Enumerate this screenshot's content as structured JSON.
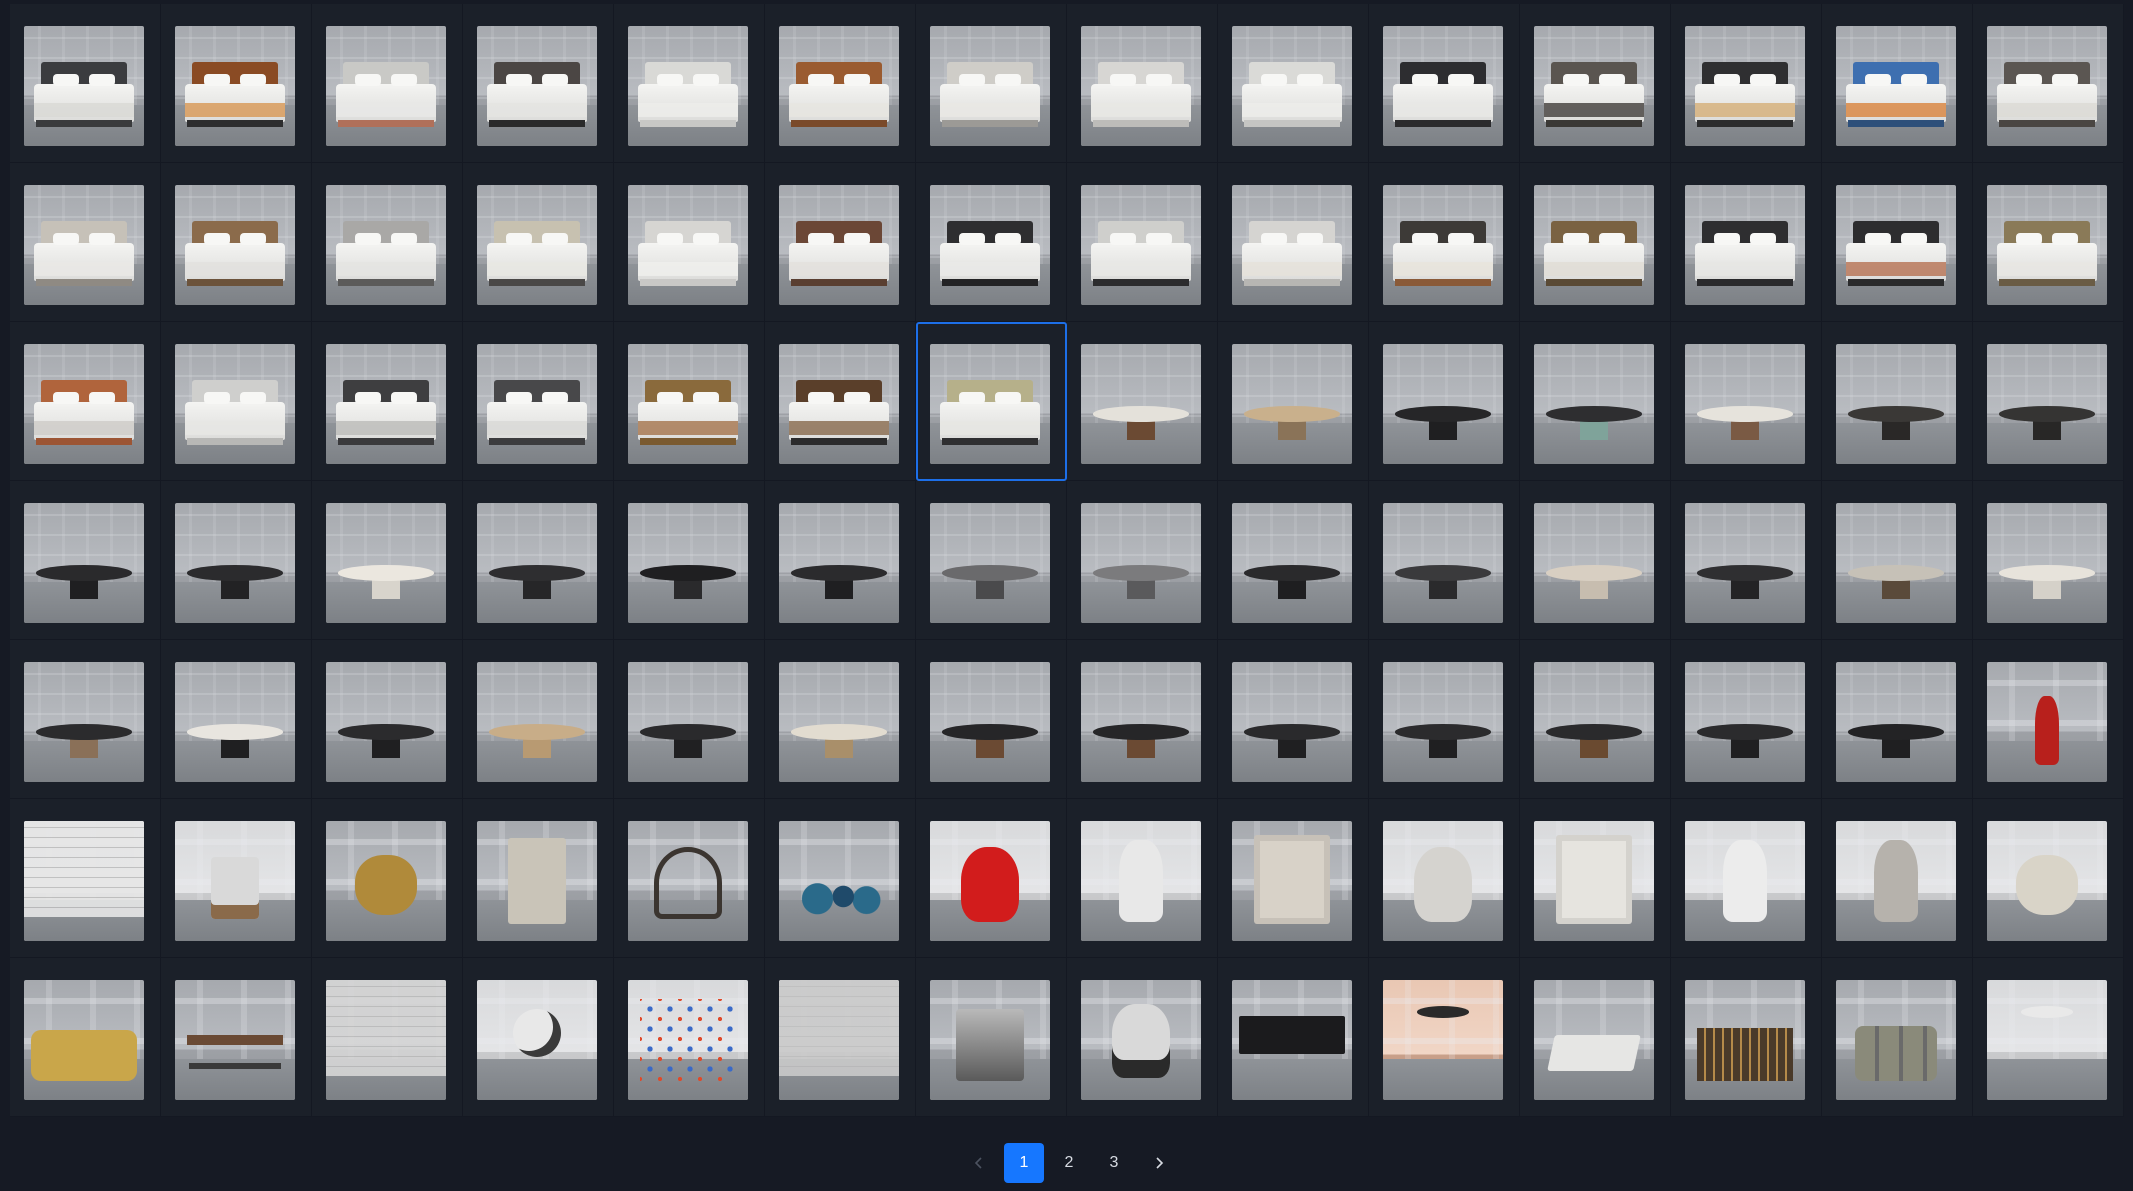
{
  "gallery": {
    "columns": 14,
    "selected_index": 34,
    "items": [
      {
        "kind": "bed",
        "head": "#3b3c3f",
        "throw": "#d9d9d6",
        "base": "#3a3b3d"
      },
      {
        "kind": "bed",
        "head": "#8a4b24",
        "throw": "#d89b5c",
        "base": "#2d2d2e"
      },
      {
        "kind": "bed",
        "head": "#c9c9c6",
        "throw": "#e8e8e6",
        "base": "#b0705a"
      },
      {
        "kind": "bed",
        "head": "#4b4644",
        "throw": "#e4e4e2",
        "base": "#2a2a2b"
      },
      {
        "kind": "bed",
        "head": "#d9d9d6",
        "throw": "#ececea",
        "base": "#c8c8c6"
      },
      {
        "kind": "bed",
        "head": "#9a5b30",
        "throw": "#e6e5e1",
        "base": "#7a4a2a"
      },
      {
        "kind": "bed",
        "head": "#cfcdc8",
        "throw": "#e9e8e4",
        "base": "#9c9a96"
      },
      {
        "kind": "bed",
        "head": "#d7d6d3",
        "throw": "#e8e7e4",
        "base": "#bdbcb9"
      },
      {
        "kind": "bed",
        "head": "#dadad7",
        "throw": "#ececea",
        "base": "#c5c5c3"
      },
      {
        "kind": "bed",
        "head": "#2d2d30",
        "throw": "#e7e7e5",
        "base": "#2b2b2d"
      },
      {
        "kind": "bed",
        "head": "#5a5550",
        "throw": "#4a4744",
        "base": "#3a3835"
      },
      {
        "kind": "bed",
        "head": "#2f2f31",
        "throw": "#d6b27e",
        "base": "#2c2c2d"
      },
      {
        "kind": "bed",
        "head": "#3e6fb0",
        "throw": "#d98845",
        "base": "#2d4f7a"
      },
      {
        "kind": "bed",
        "head": "#5b5652",
        "throw": "#dcdad6",
        "base": "#4a4643"
      },
      {
        "kind": "bed",
        "head": "#c6c1b8",
        "throw": "#e9e8e5",
        "base": "#8f8a83"
      },
      {
        "kind": "bed",
        "head": "#8b6b4b",
        "throw": "#e2e1de",
        "base": "#6c533b"
      },
      {
        "kind": "bed",
        "head": "#a9a8a6",
        "throw": "#e4e4e2",
        "base": "#5c5b5a"
      },
      {
        "kind": "bed",
        "head": "#c7c1b0",
        "throw": "#e8e7e3",
        "base": "#4a4847"
      },
      {
        "kind": "bed",
        "head": "#d6d5d2",
        "throw": "#eeeeec",
        "base": "#c9c8c6"
      },
      {
        "kind": "bed",
        "head": "#6b4736",
        "throw": "#e3e1dd",
        "base": "#5a3f31"
      },
      {
        "kind": "bed",
        "head": "#2e2e30",
        "throw": "#e9e9e7",
        "base": "#232325"
      },
      {
        "kind": "bed",
        "head": "#cfcfcc",
        "throw": "#e7e7e5",
        "base": "#2c2c2e"
      },
      {
        "kind": "bed",
        "head": "#d5d4d1",
        "throw": "#e5e2da",
        "base": "#b7b6b3"
      },
      {
        "kind": "bed",
        "head": "#3d3a37",
        "throw": "#e8e4dc",
        "base": "#8a5a38"
      },
      {
        "kind": "bed",
        "head": "#7a6242",
        "throw": "#e0ddd6",
        "base": "#5a4a35"
      },
      {
        "kind": "bed",
        "head": "#2e2e30",
        "throw": "#e6e6e4",
        "base": "#2a2a2c"
      },
      {
        "kind": "bed",
        "head": "#2d2d2f",
        "throw": "#b9785a",
        "base": "#2a2a2b"
      },
      {
        "kind": "bed",
        "head": "#8a7a58",
        "throw": "#e7e6e3",
        "base": "#6a5c45"
      },
      {
        "kind": "bed",
        "head": "#b0643c",
        "throw": "#cfcdc9",
        "base": "#9c5534"
      },
      {
        "kind": "bed",
        "head": "#cfcfcd",
        "throw": "#e6e6e4",
        "base": "#b8b8b6"
      },
      {
        "kind": "bed",
        "head": "#3e3e40",
        "throw": "#bdbdbb",
        "base": "#3a3a3c"
      },
      {
        "kind": "bed",
        "head": "#48484a",
        "throw": "#d9d9d7",
        "base": "#3c3c3e"
      },
      {
        "kind": "bed",
        "head": "#8a6a3c",
        "throw": "#a87a55",
        "base": "#7a5a30"
      },
      {
        "kind": "bed",
        "head": "#5a3f2a",
        "throw": "#8c7055",
        "base": "#2b2b2c"
      },
      {
        "kind": "bed",
        "head": "#b6b08a",
        "throw": "#e6e6e3",
        "base": "#2f2f31"
      },
      {
        "kind": "table",
        "top": "#e4e1da",
        "leg": "#6b4a33"
      },
      {
        "kind": "table",
        "top": "#c9b08c",
        "leg": "#8a7358"
      },
      {
        "kind": "table",
        "top": "#262628",
        "leg": "#1f1f21"
      },
      {
        "kind": "table",
        "top": "#2e2e30",
        "leg": "#7fa39a"
      },
      {
        "kind": "table",
        "top": "#e6e3dc",
        "leg": "#7a5a44"
      },
      {
        "kind": "table",
        "top": "#3a3836",
        "leg": "#2a2827"
      },
      {
        "kind": "table",
        "top": "#353433",
        "leg": "#282726"
      },
      {
        "kind": "table",
        "top": "#2a2a2c",
        "leg": "#1f1f21"
      },
      {
        "kind": "table",
        "top": "#2b2b2d",
        "leg": "#222224"
      },
      {
        "kind": "table",
        "top": "#ebe7df",
        "leg": "#d8d4cc"
      },
      {
        "kind": "table",
        "top": "#2e2e30",
        "leg": "#262628"
      },
      {
        "kind": "table",
        "top": "#1f1f21",
        "leg": "#2a2a2c"
      },
      {
        "kind": "table",
        "top": "#2b2b2d",
        "leg": "#1f1f21"
      },
      {
        "kind": "table",
        "top": "#6a6a6c",
        "leg": "#4a4a4c"
      },
      {
        "kind": "table",
        "top": "#7b7b7d",
        "leg": "#5a5a5c"
      },
      {
        "kind": "table",
        "top": "#2a2a2c",
        "leg": "#1e1e20"
      },
      {
        "kind": "table",
        "top": "#3a3a3c",
        "leg": "#2a2a2c"
      },
      {
        "kind": "table",
        "top": "#d8cfc2",
        "leg": "#c7bdaf"
      },
      {
        "kind": "table",
        "top": "#2f2f31",
        "leg": "#232325"
      },
      {
        "kind": "table",
        "top": "#c6c1b7",
        "leg": "#5a4a3a"
      },
      {
        "kind": "table",
        "top": "#e7e3db",
        "leg": "#d5d1c9"
      },
      {
        "kind": "table",
        "top": "#2b2b2d",
        "leg": "#8a7058"
      },
      {
        "kind": "table",
        "top": "#e8e5df",
        "leg": "#1f1f21"
      },
      {
        "kind": "table",
        "top": "#2b2b2d",
        "leg": "#1f1f21"
      },
      {
        "kind": "table",
        "top": "#c8ad88",
        "leg": "#b89a72"
      },
      {
        "kind": "table",
        "top": "#2a2a2c",
        "leg": "#202022"
      },
      {
        "kind": "table",
        "top": "#e2dcd0",
        "leg": "#a98f6a"
      },
      {
        "kind": "table",
        "top": "#262628",
        "leg": "#6b4a33"
      },
      {
        "kind": "table",
        "top": "#262628",
        "leg": "#6b4a33"
      },
      {
        "kind": "table",
        "top": "#2a2a2c",
        "leg": "#1f1f21"
      },
      {
        "kind": "table",
        "top": "#2b2b2d",
        "leg": "#1f1f21"
      },
      {
        "kind": "table",
        "top": "#2a2a2c",
        "leg": "#6a4a30"
      },
      {
        "kind": "table",
        "top": "#2b2b2d",
        "leg": "#1f1f21"
      },
      {
        "kind": "table",
        "top": "#232325",
        "leg": "#1f1f21"
      },
      {
        "kind": "decor",
        "color": "#b8201c",
        "shape": "hydrant"
      },
      {
        "kind": "decor",
        "color": "#e6e6e6",
        "shape": "wall",
        "light": true
      },
      {
        "kind": "decor",
        "color": "#d9d9d9",
        "shape": "appliance",
        "light": true
      },
      {
        "kind": "decor",
        "color": "#b08a3a",
        "shape": "blob"
      },
      {
        "kind": "decor",
        "color": "#c9c4b8",
        "shape": "fridge"
      },
      {
        "kind": "decor",
        "color": "#3b3530",
        "shape": "sculpture"
      },
      {
        "kind": "decor",
        "color": "#2a6a8a",
        "shape": "vases"
      },
      {
        "kind": "decor",
        "color": "#d21c1c",
        "shape": "head",
        "light": true
      },
      {
        "kind": "decor",
        "color": "#e8e8e8",
        "shape": "torso",
        "light": true
      },
      {
        "kind": "decor",
        "color": "#d8d2c8",
        "shape": "relief"
      },
      {
        "kind": "decor",
        "color": "#d5d3cf",
        "shape": "head",
        "light": true
      },
      {
        "kind": "decor",
        "color": "#e6e4df",
        "shape": "relief",
        "light": true
      },
      {
        "kind": "decor",
        "color": "#ececec",
        "shape": "torso",
        "light": true
      },
      {
        "kind": "decor",
        "color": "#b6b2ac",
        "shape": "torso",
        "light": true
      },
      {
        "kind": "decor",
        "color": "#d9d4c8",
        "shape": "blob",
        "light": true
      },
      {
        "kind": "decor",
        "color": "#c9a64a",
        "shape": "sofa"
      },
      {
        "kind": "decor",
        "color": "#6a4a34",
        "shape": "desk"
      },
      {
        "kind": "decor",
        "color": "#d6d6d6",
        "shape": "wall"
      },
      {
        "kind": "decor",
        "color": "#e8e8e8",
        "shape": "robot",
        "light": true
      },
      {
        "kind": "decor",
        "color": "#3a6ac8",
        "shape": "swatches",
        "light": true
      },
      {
        "kind": "decor",
        "color": "#c9c9c9",
        "shape": "wall",
        "light": true
      },
      {
        "kind": "decor",
        "color": "#5a5a5a",
        "shape": "machine"
      },
      {
        "kind": "decor",
        "color": "#d9d9d9",
        "shape": "helmet"
      },
      {
        "kind": "decor",
        "color": "#1b1b1d",
        "shape": "monitors"
      },
      {
        "kind": "decor",
        "color": "#2a2a2a",
        "shape": "lamp",
        "warm": true
      },
      {
        "kind": "decor",
        "color": "#e6e6e4",
        "shape": "book"
      },
      {
        "kind": "decor",
        "color": "#4a3a2a",
        "shape": "bottles"
      },
      {
        "kind": "decor",
        "color": "#8a8a7a",
        "shape": "jars"
      },
      {
        "kind": "decor",
        "color": "#e9e9e9",
        "shape": "lamp",
        "light": true
      }
    ]
  },
  "pagination": {
    "prev_label": "‹",
    "next_label": "›",
    "pages": [
      "1",
      "2",
      "3"
    ],
    "current": "1"
  }
}
